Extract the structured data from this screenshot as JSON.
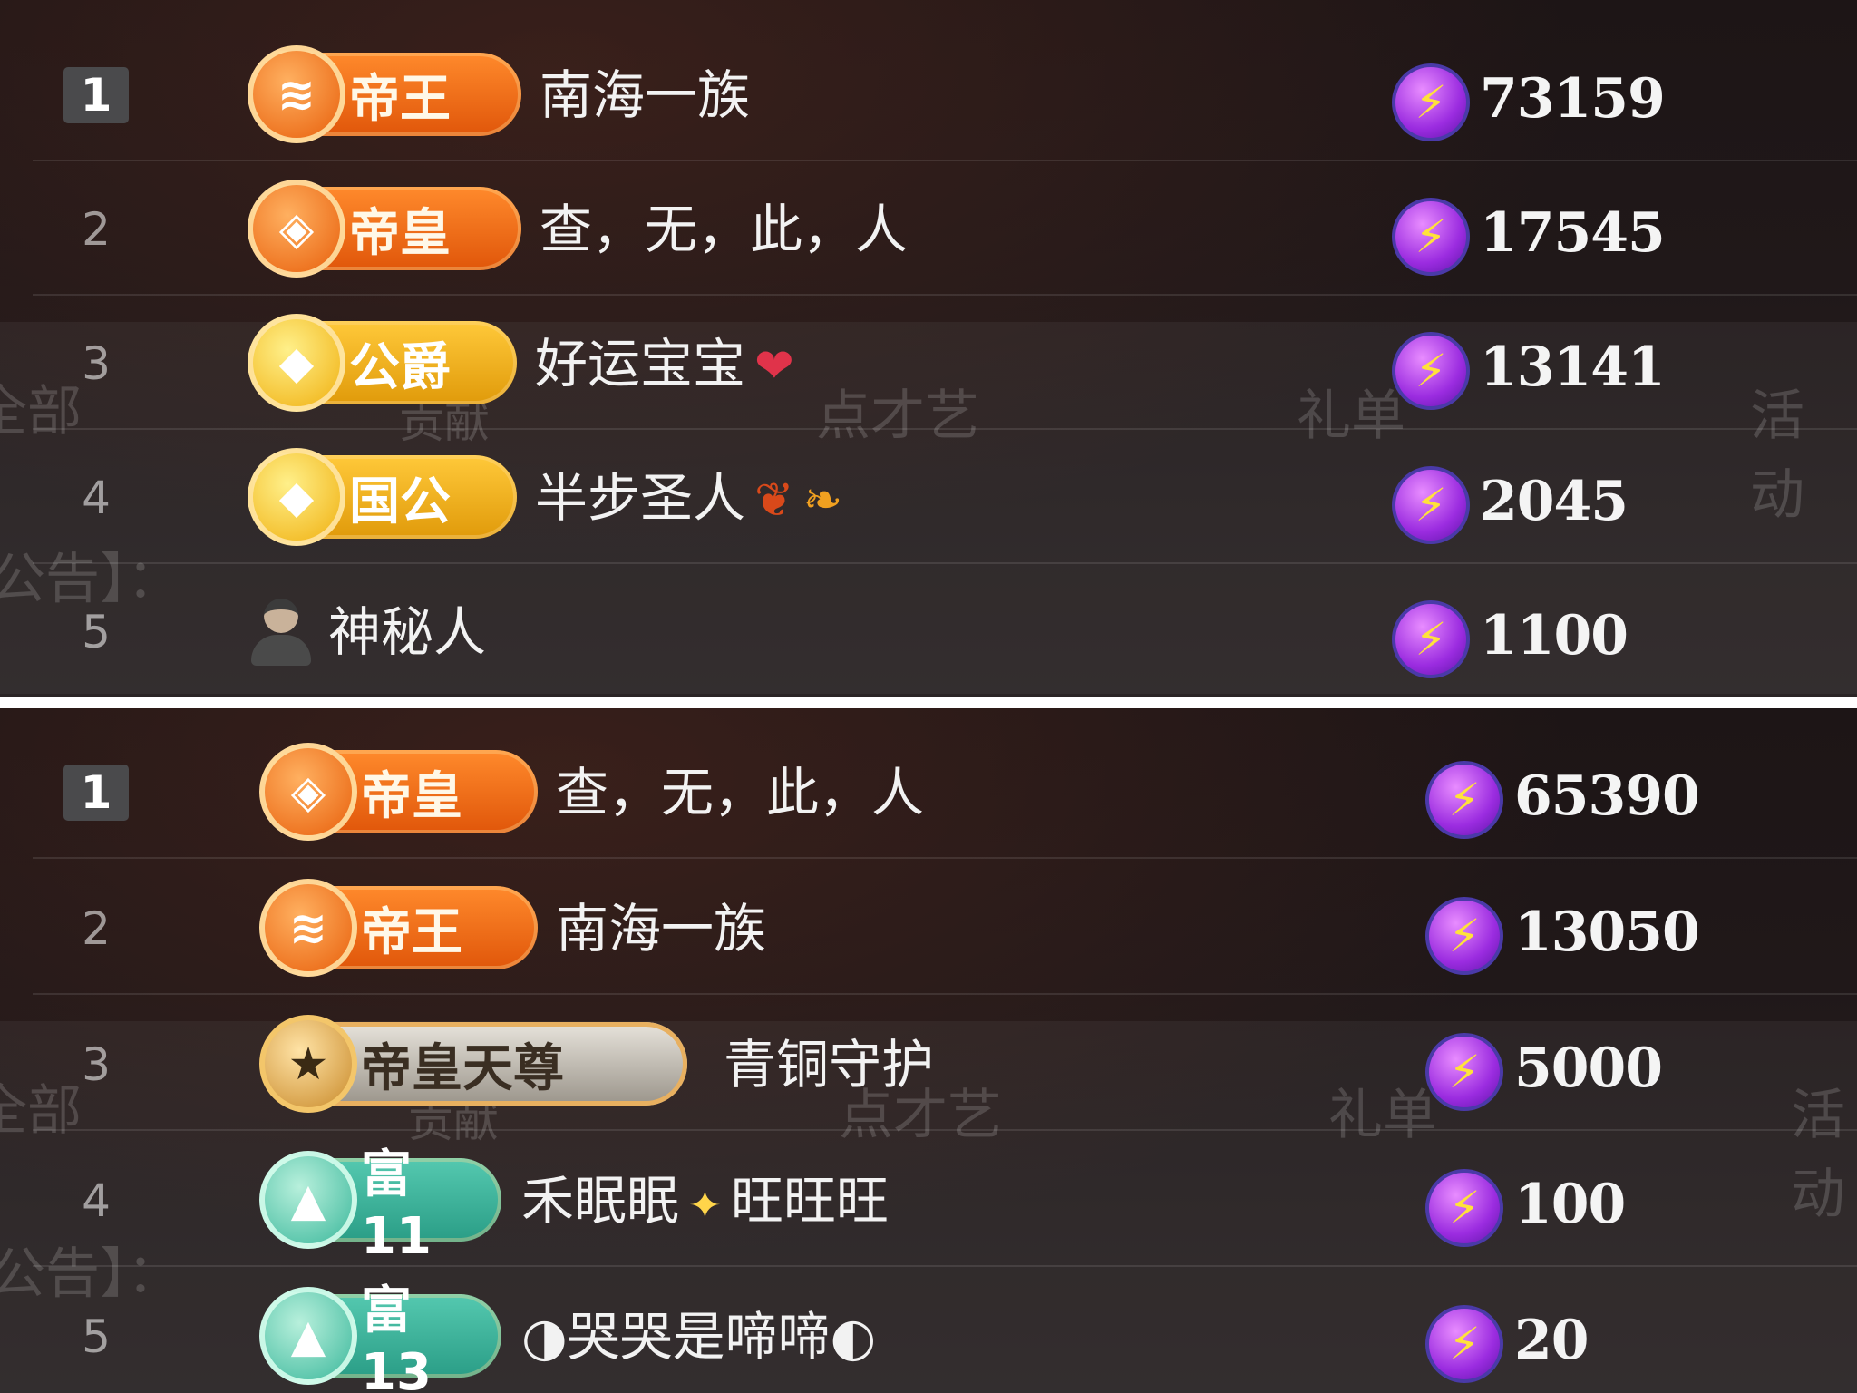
{
  "panels": [
    {
      "rows": [
        {
          "rank": "1",
          "badge": {
            "label": "帝王",
            "style": "orange",
            "emblem": "≋"
          },
          "name": "南海一族",
          "decorations": [],
          "score": "73159"
        },
        {
          "rank": "2",
          "badge": {
            "label": "帝皇",
            "style": "orange",
            "emblem": "◈"
          },
          "name": "查，无，此，人",
          "decorations": [],
          "score": "17545"
        },
        {
          "rank": "3",
          "badge": {
            "label": "公爵",
            "style": "gold",
            "emblem": "◆"
          },
          "name": "好运宝宝",
          "decorations": [
            "heart"
          ],
          "score": "13141"
        },
        {
          "rank": "4",
          "badge": {
            "label": "国公",
            "style": "gold",
            "emblem": "◆"
          },
          "name": "半步圣人",
          "decorations": [
            "leaf",
            "leaf2"
          ],
          "score": "2045"
        },
        {
          "rank": "5",
          "badge": null,
          "name": "神秘人",
          "decorations": [],
          "score": "1100"
        }
      ]
    },
    {
      "rows": [
        {
          "rank": "1",
          "badge": {
            "label": "帝皇",
            "style": "orange",
            "emblem": "◈"
          },
          "name": "查，无，此，人",
          "decorations": [],
          "score": "65390"
        },
        {
          "rank": "2",
          "badge": {
            "label": "帝王",
            "style": "orange",
            "emblem": "≋"
          },
          "name": "南海一族",
          "decorations": [],
          "score": "13050"
        },
        {
          "rank": "3",
          "badge": {
            "label": "帝皇天尊",
            "style": "silver",
            "emblem": "★"
          },
          "name": "青铜守护",
          "decorations": [],
          "score": "5000"
        },
        {
          "rank": "4",
          "badge": {
            "label": "富11",
            "style": "teal",
            "emblem": "▲"
          },
          "name": "禾眠眠",
          "name2": "旺旺旺",
          "decorations": [
            "spark"
          ],
          "score": "100"
        },
        {
          "rank": "5",
          "badge": {
            "label": "富13",
            "style": "teal",
            "emblem": "▲"
          },
          "name": "◑哭哭是啼啼◐",
          "decorations": [],
          "score": "20"
        }
      ]
    }
  ],
  "background_ghost_text": {
    "all": "全部",
    "notice": "公告】：",
    "tabs": [
      "点才艺",
      "礼单",
      "活动"
    ],
    "contributor": "贡献"
  },
  "icons": {
    "coin": "lightning-coin-icon",
    "avatar": "mystery-person-avatar-icon",
    "heart": "heart-icon",
    "leaf": "maple-leaf-icon",
    "spark": "sparkle-icon"
  },
  "colors": {
    "badge_orange": "#e0560a",
    "badge_gold": "#e09a0a",
    "badge_teal": "#2a9d86",
    "coin_purple": "#9b2ce0",
    "lightning_yellow": "#ffe23a"
  }
}
